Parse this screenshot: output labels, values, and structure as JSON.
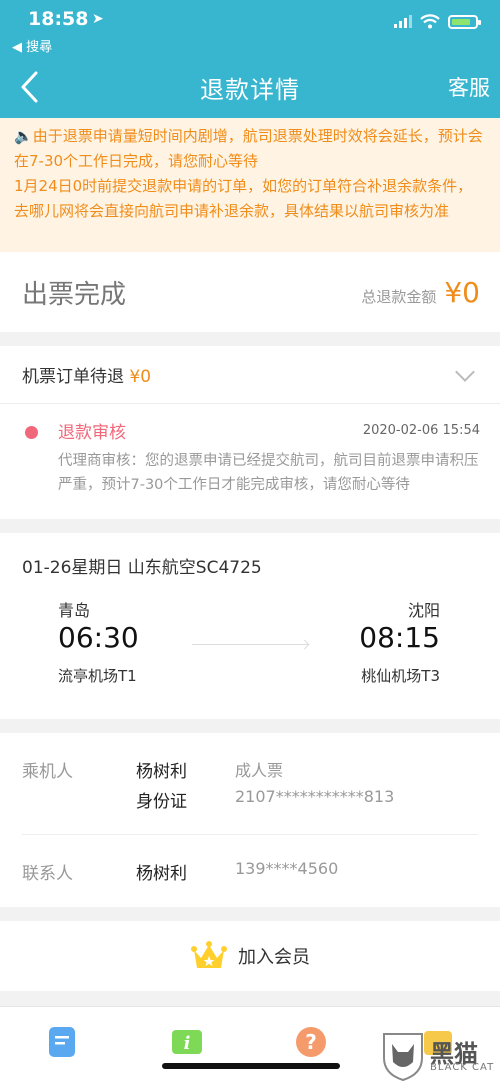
{
  "status_bar": {
    "time": "18:58",
    "back_app": "◀ 搜尋"
  },
  "nav": {
    "title": "退款详情",
    "service": "客服"
  },
  "notice": {
    "text": "由于退票申请量短时间内剧增，航司退票处理时效将会延长，预计会在7-30个工作日完成，请您耐心等待",
    "text2": "1月24日0时前提交退款申请的订单，如您的订单符合补退余款条件，去哪儿网将会直接向航司申请补退余款，具体结果以航司审核为准"
  },
  "summary": {
    "status": "出票完成",
    "amount_label": "总退款金额",
    "amount": "¥0"
  },
  "refund": {
    "label": "机票订单待退",
    "amount": "¥0",
    "review_title": "退款审核",
    "review_time": "2020-02-06 15:54",
    "review_desc": "代理商审核：您的退票申请已经提交航司，航司目前退票申请积压严重，预计7-30个工作日才能完成审核，请您耐心等待"
  },
  "flight": {
    "header": "01-26星期日  山东航空SC4725",
    "from_city": "青岛",
    "from_time": "06:30",
    "from_airport": "流亭机场T1",
    "to_city": "沈阳",
    "to_time": "08:15",
    "to_airport": "桃仙机场T3"
  },
  "passenger": {
    "label": "乘机人",
    "name": "杨树利",
    "ticket_type": "成人票",
    "id_type": "身份证",
    "id_number": "2107***********813"
  },
  "contact": {
    "label": "联系人",
    "name": "杨树利",
    "phone": "139****4560"
  },
  "member": {
    "label": "加入会员"
  },
  "watermark": {
    "text": "黑猫",
    "sub": "BLACK CAT"
  },
  "colors": {
    "nav_bg": "#39b6cf",
    "accent_orange": "#f08c1a",
    "review_red": "#f0687a"
  }
}
